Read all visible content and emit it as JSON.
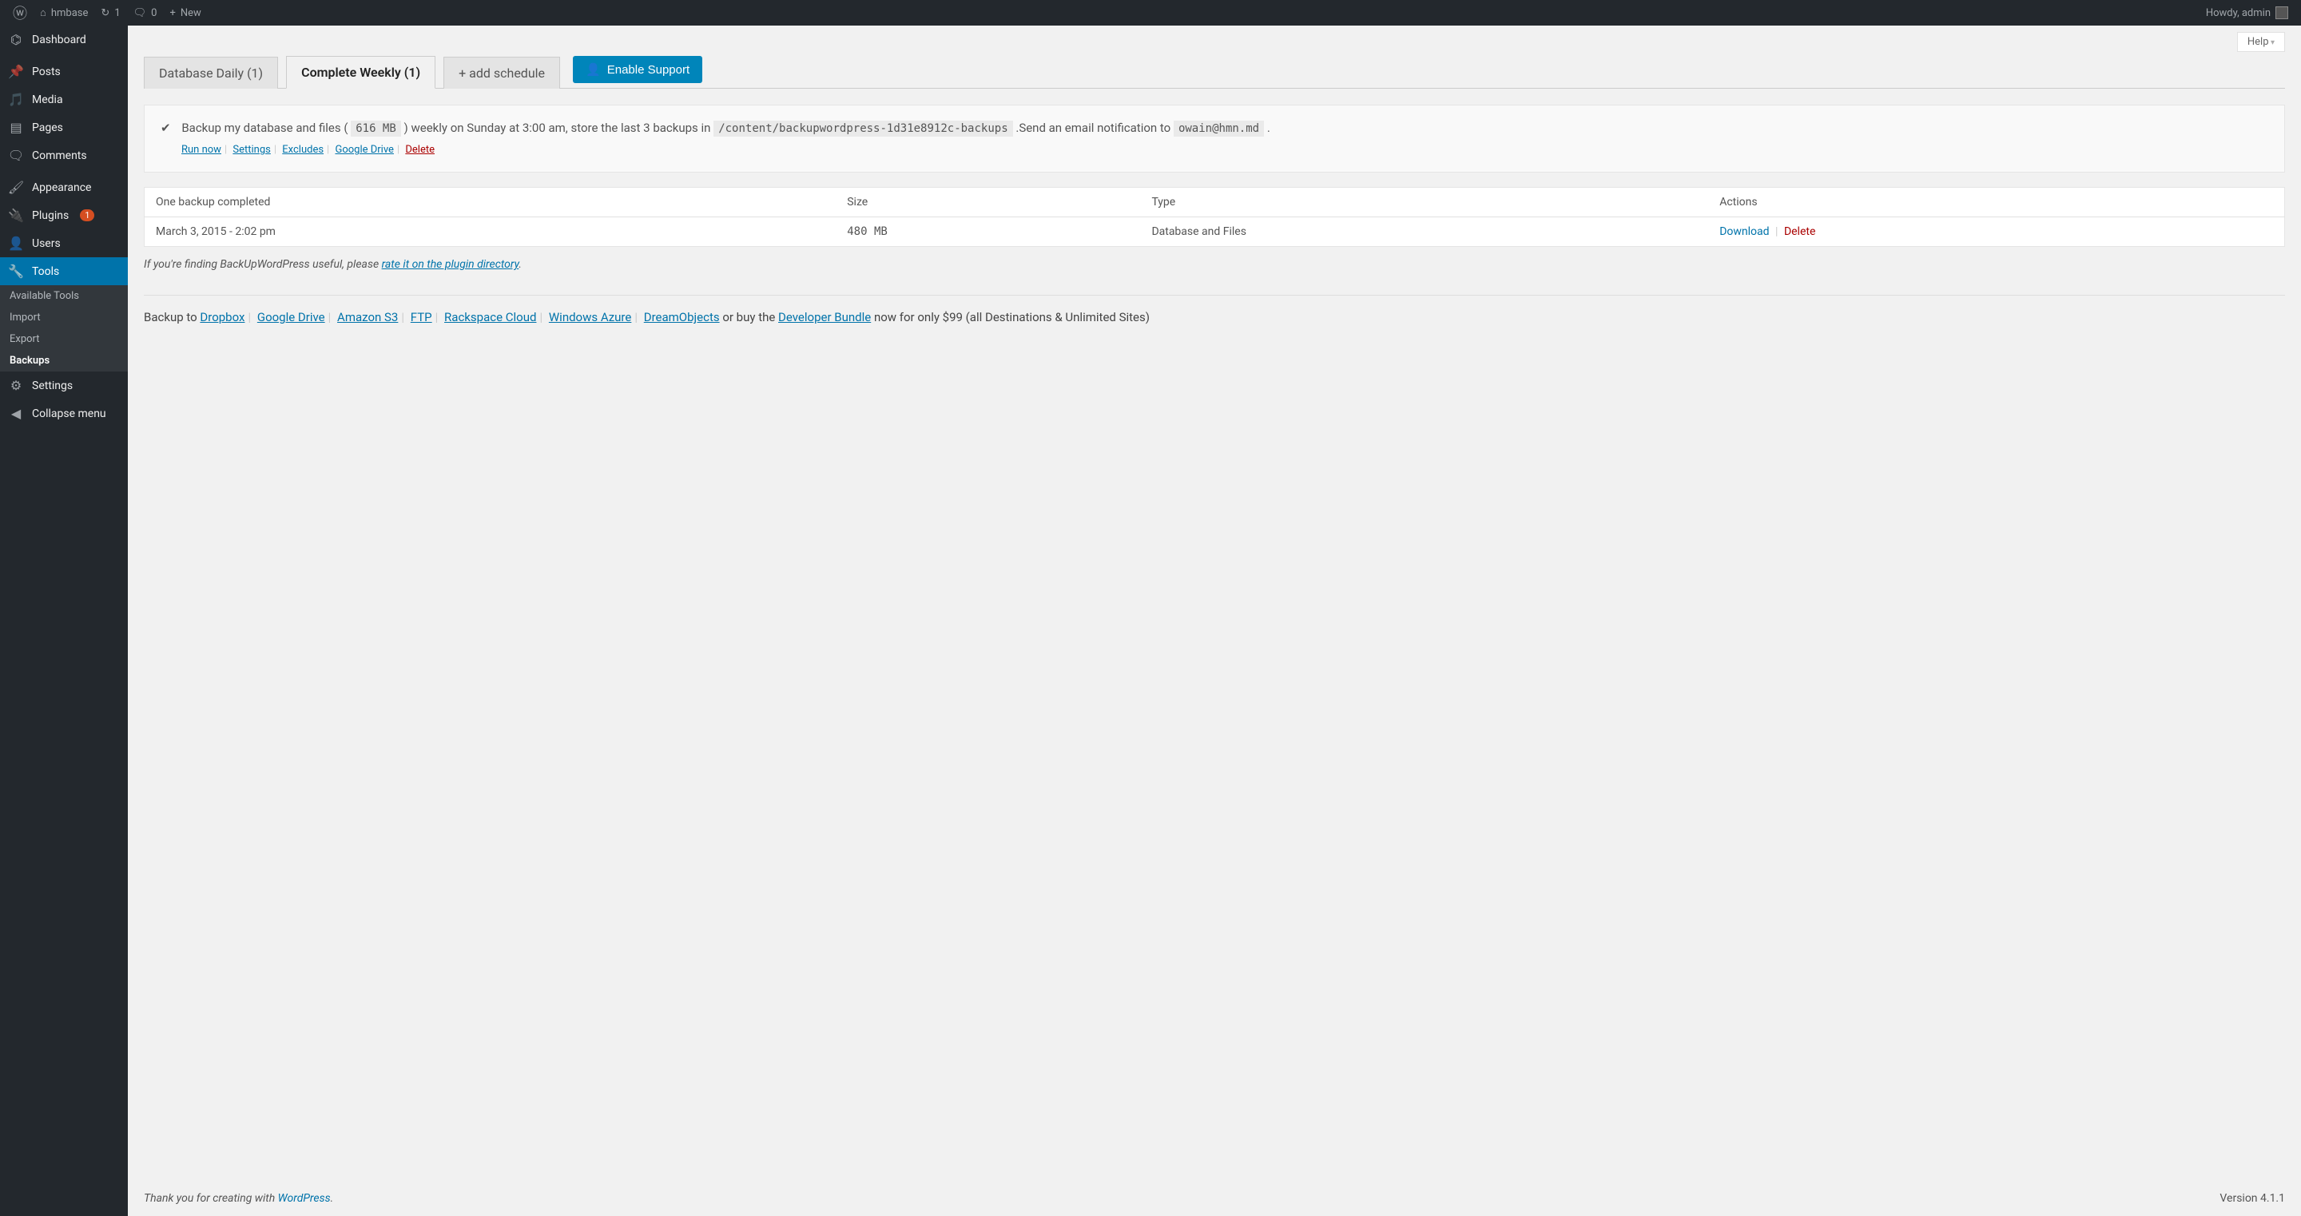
{
  "adminBar": {
    "siteName": "hmbase",
    "updates": "1",
    "comments": "0",
    "new": "New",
    "greeting": "Howdy, admin"
  },
  "sidebar": {
    "dashboard": "Dashboard",
    "posts": "Posts",
    "media": "Media",
    "pages": "Pages",
    "comments": "Comments",
    "appearance": "Appearance",
    "plugins": "Plugins",
    "pluginsBadge": "1",
    "users": "Users",
    "tools": "Tools",
    "toolsSub": {
      "available": "Available Tools",
      "import": "Import",
      "export": "Export",
      "backups": "Backups"
    },
    "settings": "Settings",
    "collapse": "Collapse menu"
  },
  "help": "Help",
  "tabs": {
    "daily": "Database Daily (1)",
    "weekly": "Complete Weekly (1)",
    "add": "+ add schedule"
  },
  "enableSupport": "Enable Support",
  "desc": {
    "pre": "Backup my database and files (",
    "size": "616 MB",
    "mid1": ") weekly on Sunday at 3:00 am, store the last 3 backups in ",
    "path": "/content/backupwordpress-1d31e8912c-backups",
    "mid2": ".Send an email notification to ",
    "email": "owain@hmn.md",
    "end": "."
  },
  "descLinks": {
    "run": "Run now",
    "settings": "Settings",
    "excludes": "Excludes",
    "gdrive": "Google Drive",
    "delete": "Delete"
  },
  "table": {
    "headerStatus": "One backup completed",
    "headerSize": "Size",
    "headerType": "Type",
    "headerActions": "Actions",
    "row": {
      "date": "March 3, 2015 - 2:02 pm",
      "size": "480 MB",
      "type": "Database and Files",
      "download": "Download",
      "delete": "Delete"
    }
  },
  "rate": {
    "pre": "If you're finding BackUpWordPress useful, please ",
    "link": "rate it on the plugin directory",
    "post": "."
  },
  "dest": {
    "pre": "Backup to  ",
    "dropbox": "Dropbox",
    "gdrive": "Google Drive",
    "s3": "Amazon S3",
    "ftp": "FTP",
    "rackspace": "Rackspace Cloud",
    "azure": "Windows Azure",
    "dreamobjects": "DreamObjects",
    "mid": "   or buy the ",
    "bundle": "Developer Bundle",
    "post": " now for only $99 (all Destinations & Unlimited Sites)"
  },
  "footer": {
    "pre": "Thank you for creating with ",
    "wp": "WordPress",
    "post": ".",
    "version": "Version 4.1.1"
  }
}
